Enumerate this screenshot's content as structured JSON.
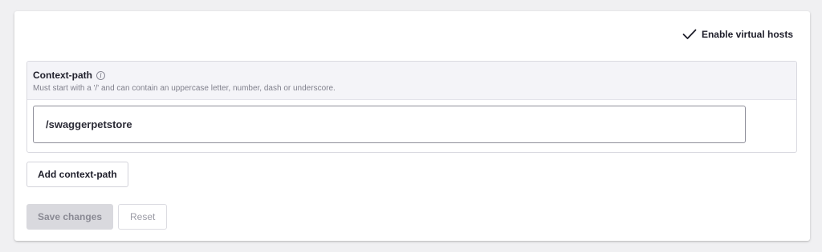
{
  "virtual_hosts": {
    "label": "Enable virtual hosts",
    "checked": true
  },
  "context_path": {
    "title": "Context-path",
    "info_icon": "info-icon",
    "hint": "Must start with a '/' and can contain an uppercase letter, number, dash or underscore.",
    "value": "/swaggerpetstore"
  },
  "buttons": {
    "add_context_path": "Add context-path",
    "save_changes": "Save changes",
    "reset": "Reset"
  },
  "colors": {
    "page_background": "#f0f0f2",
    "card_background": "#ffffff",
    "panel_header_background": "#f4f4f8",
    "disabled_button_background": "#d9d9de"
  }
}
